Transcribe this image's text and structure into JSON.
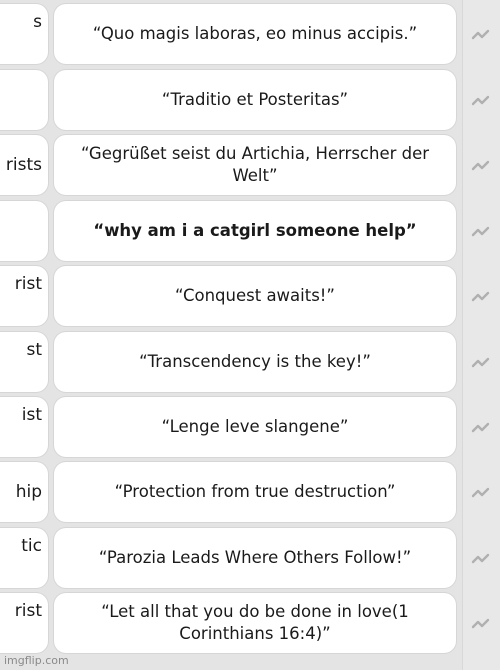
{
  "rows": [
    {
      "left_text": "s",
      "quote": "“Quo magis laboras, eo minus accipis.”",
      "bold": false
    },
    {
      "left_text": "",
      "quote": "“Traditio et Posteritas”",
      "bold": false
    },
    {
      "left_text": "rists",
      "quote": "“Gegrüßet seist du Artichia, Herrscher der Welt”",
      "bold": false
    },
    {
      "left_text": "",
      "quote": "“why am i a catgirl someone help”",
      "bold": true
    },
    {
      "left_text": "rist",
      "quote": "“Conquest awaits!”",
      "bold": false
    },
    {
      "left_text": "st",
      "quote": "“Transcendency is the key!”",
      "bold": false
    },
    {
      "left_text": "ist",
      "quote": "“Lenge leve slangene”",
      "bold": false
    },
    {
      "left_text": "hip",
      "quote": "“Protection from true destruction”",
      "bold": false
    },
    {
      "left_text": "tic",
      "quote": "“Parozia Leads Where Others Follow!”",
      "bold": false
    },
    {
      "left_text": "rist",
      "quote": "“Let all that you do be done in love(1 Corinthians 16:4)”",
      "bold": false
    }
  ],
  "row_icon": "trend-squiggle-icon",
  "watermark": "imgflip.com",
  "colors": {
    "cell_bg": "#ffffff",
    "page_bg": "#e4e4e4",
    "icon": "#b0b0b0"
  }
}
